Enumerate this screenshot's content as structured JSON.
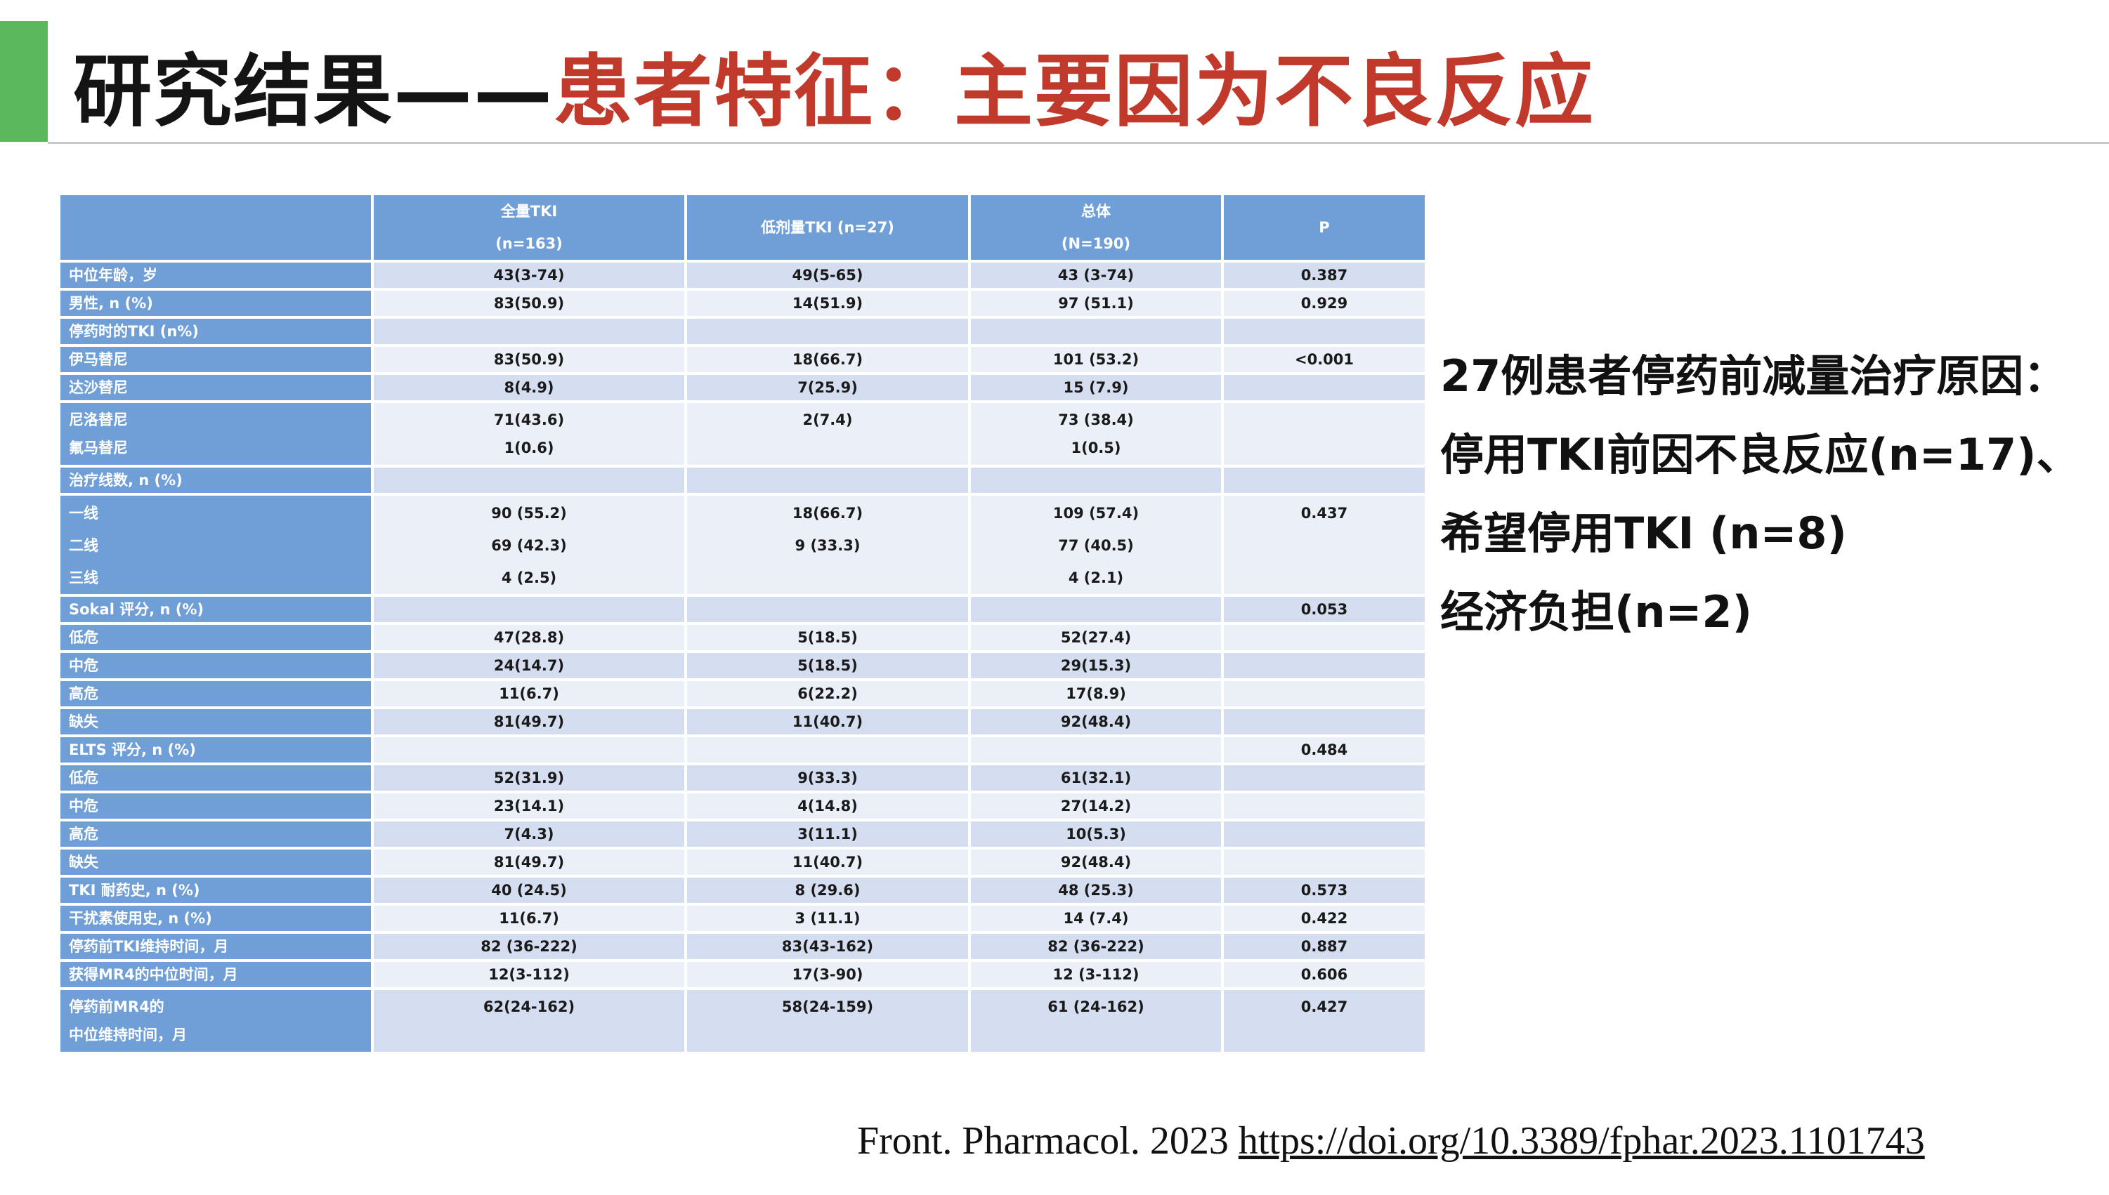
{
  "title": {
    "part1": "研究结果——",
    "part2": "患者特征：主要因为不良反应"
  },
  "table": {
    "headers": [
      {
        "line1": "",
        "line2": ""
      },
      {
        "line1": "全量TKI",
        "line2": "(n=163)"
      },
      {
        "line1": "低剂量TKI (n=27)",
        "line2": ""
      },
      {
        "line1": "总体",
        "line2": "(N=190)"
      },
      {
        "line1": "P",
        "line2": ""
      }
    ],
    "rows": [
      {
        "label": [
          "中位年龄，岁"
        ],
        "c1": [
          "43(3-74)"
        ],
        "c2": [
          "49(5-65)"
        ],
        "c3": [
          "43 (3-74)"
        ],
        "p": [
          "0.387"
        ]
      },
      {
        "label": [
          "男性, n (%)"
        ],
        "c1": [
          "83(50.9)"
        ],
        "c2": [
          "14(51.9)"
        ],
        "c3": [
          "97 (51.1)"
        ],
        "p": [
          "0.929"
        ]
      },
      {
        "label": [
          "停药时的TKI (n%)"
        ],
        "c1": [
          ""
        ],
        "c2": [
          ""
        ],
        "c3": [
          ""
        ],
        "p": [
          ""
        ]
      },
      {
        "label": [
          "伊马替尼"
        ],
        "c1": [
          "83(50.9)"
        ],
        "c2": [
          "18(66.7)"
        ],
        "c3": [
          "101 (53.2)"
        ],
        "p": [
          "<0.001"
        ]
      },
      {
        "label": [
          "达沙替尼"
        ],
        "c1": [
          "8(4.9)"
        ],
        "c2": [
          "7(25.9)"
        ],
        "c3": [
          "15 (7.9)"
        ],
        "p": [
          ""
        ]
      },
      {
        "label": [
          "尼洛替尼",
          "氟马替尼"
        ],
        "c1": [
          "71(43.6)",
          "1(0.6)"
        ],
        "c2": [
          "2(7.4)",
          ""
        ],
        "c3": [
          "73 (38.4)",
          "1(0.5)"
        ],
        "p": [
          "",
          ""
        ]
      },
      {
        "label": [
          "治疗线数, n (%)"
        ],
        "c1": [
          ""
        ],
        "c2": [
          ""
        ],
        "c3": [
          ""
        ],
        "p": [
          ""
        ]
      },
      {
        "label": [
          "一线",
          "二线",
          "三线"
        ],
        "c1": [
          "90 (55.2)",
          "69 (42.3)",
          "4 (2.5)"
        ],
        "c2": [
          "18(66.7)",
          "9 (33.3)",
          ""
        ],
        "c3": [
          "109 (57.4)",
          "77 (40.5)",
          "4 (2.1)"
        ],
        "p": [
          "0.437",
          "",
          ""
        ]
      },
      {
        "label": [
          "Sokal 评分, n (%)"
        ],
        "c1": [
          ""
        ],
        "c2": [
          ""
        ],
        "c3": [
          ""
        ],
        "p": [
          "0.053"
        ]
      },
      {
        "label": [
          "低危"
        ],
        "c1": [
          "47(28.8)"
        ],
        "c2": [
          "5(18.5)"
        ],
        "c3": [
          "52(27.4)"
        ],
        "p": [
          ""
        ]
      },
      {
        "label": [
          "中危"
        ],
        "c1": [
          "24(14.7)"
        ],
        "c2": [
          "5(18.5)"
        ],
        "c3": [
          "29(15.3)"
        ],
        "p": [
          ""
        ]
      },
      {
        "label": [
          "高危"
        ],
        "c1": [
          "11(6.7)"
        ],
        "c2": [
          "6(22.2)"
        ],
        "c3": [
          "17(8.9)"
        ],
        "p": [
          ""
        ]
      },
      {
        "label": [
          "缺失"
        ],
        "c1": [
          "81(49.7)"
        ],
        "c2": [
          "11(40.7)"
        ],
        "c3": [
          "92(48.4)"
        ],
        "p": [
          ""
        ]
      },
      {
        "label": [
          "ELTS 评分, n (%)"
        ],
        "c1": [
          ""
        ],
        "c2": [
          ""
        ],
        "c3": [
          ""
        ],
        "p": [
          "0.484"
        ]
      },
      {
        "label": [
          "低危"
        ],
        "c1": [
          "52(31.9)"
        ],
        "c2": [
          "9(33.3)"
        ],
        "c3": [
          "61(32.1)"
        ],
        "p": [
          ""
        ]
      },
      {
        "label": [
          "中危"
        ],
        "c1": [
          "23(14.1)"
        ],
        "c2": [
          "4(14.8)"
        ],
        "c3": [
          "27(14.2)"
        ],
        "p": [
          ""
        ]
      },
      {
        "label": [
          "高危"
        ],
        "c1": [
          "7(4.3)"
        ],
        "c2": [
          "3(11.1)"
        ],
        "c3": [
          "10(5.3)"
        ],
        "p": [
          ""
        ]
      },
      {
        "label": [
          "缺失"
        ],
        "c1": [
          "81(49.7)"
        ],
        "c2": [
          "11(40.7)"
        ],
        "c3": [
          "92(48.4)"
        ],
        "p": [
          ""
        ]
      },
      {
        "label": [
          "TKI 耐药史, n (%)"
        ],
        "c1": [
          "40 (24.5)"
        ],
        "c2": [
          "8 (29.6)"
        ],
        "c3": [
          "48 (25.3)"
        ],
        "p": [
          "0.573"
        ]
      },
      {
        "label": [
          "干扰素使用史, n (%)"
        ],
        "c1": [
          "11(6.7)"
        ],
        "c2": [
          "3 (11.1)"
        ],
        "c3": [
          "14 (7.4)"
        ],
        "p": [
          "0.422"
        ]
      },
      {
        "label": [
          "停药前TKI维持时间，月"
        ],
        "c1": [
          "82 (36-222)"
        ],
        "c2": [
          "83(43-162)"
        ],
        "c3": [
          "82 (36-222)"
        ],
        "p": [
          "0.887"
        ]
      },
      {
        "label": [
          "获得MR4的中位时间，月"
        ],
        "c1": [
          "12(3-112)"
        ],
        "c2": [
          "17(3-90)"
        ],
        "c3": [
          "12 (3-112)"
        ],
        "p": [
          "0.606"
        ]
      },
      {
        "label": [
          "停药前MR4的",
          "中位维持时间，月"
        ],
        "c1": [
          "62(24-162)",
          ""
        ],
        "c2": [
          "58(24-159)",
          ""
        ],
        "c3": [
          "61 (24-162)",
          ""
        ],
        "p": [
          "0.427",
          ""
        ]
      }
    ]
  },
  "side_text": [
    "27例患者停药前减量治疗原因：",
    "停用TKI前因不良反应(n=17)、",
    "希望停用TKI (n=8)",
    "经济负担(n=2)"
  ],
  "citation": {
    "source": "Front. Pharmacol. 2023 ",
    "doi": "https://doi.org/10.3389/fphar.2023.1101743"
  },
  "colors": {
    "accent_bar": "#5cb85c",
    "title_highlight": "#c0392b",
    "header_bg": "#6f9fd6",
    "row_odd": "#d5def0",
    "row_even": "#ebeff8"
  }
}
